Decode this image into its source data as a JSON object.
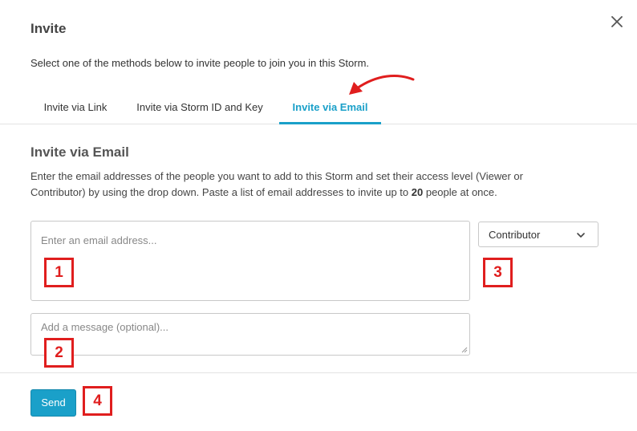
{
  "dialog": {
    "title": "Invite",
    "close_icon": "close-icon",
    "intro": "Select one of the methods below to invite people to join you in this Storm."
  },
  "tabs": [
    {
      "label": "Invite via Link",
      "active": false
    },
    {
      "label": "Invite via Storm ID and Key",
      "active": false
    },
    {
      "label": "Invite via Email",
      "active": true
    }
  ],
  "section": {
    "title": "Invite via Email",
    "desc_part1": "Enter the email addresses of the people you want to add to this Storm and set their access level (Viewer or Contributor) by using the drop down. Paste a list of email addresses to invite up to ",
    "desc_bold": "20",
    "desc_part2": " people at once."
  },
  "email_input": {
    "placeholder": "Enter an email address...",
    "value": ""
  },
  "role_select": {
    "value": "Contributor",
    "icon": "chevron-down-icon"
  },
  "message_input": {
    "placeholder": "Add a message (optional)...",
    "value": ""
  },
  "send_button": {
    "label": "Send"
  },
  "annotations": {
    "badge1": "1",
    "badge2": "2",
    "badge3": "3",
    "badge4": "4",
    "arrow_color": "#e01e1e"
  },
  "colors": {
    "accent": "#1aa0c9",
    "annotation": "#e01e1e"
  }
}
